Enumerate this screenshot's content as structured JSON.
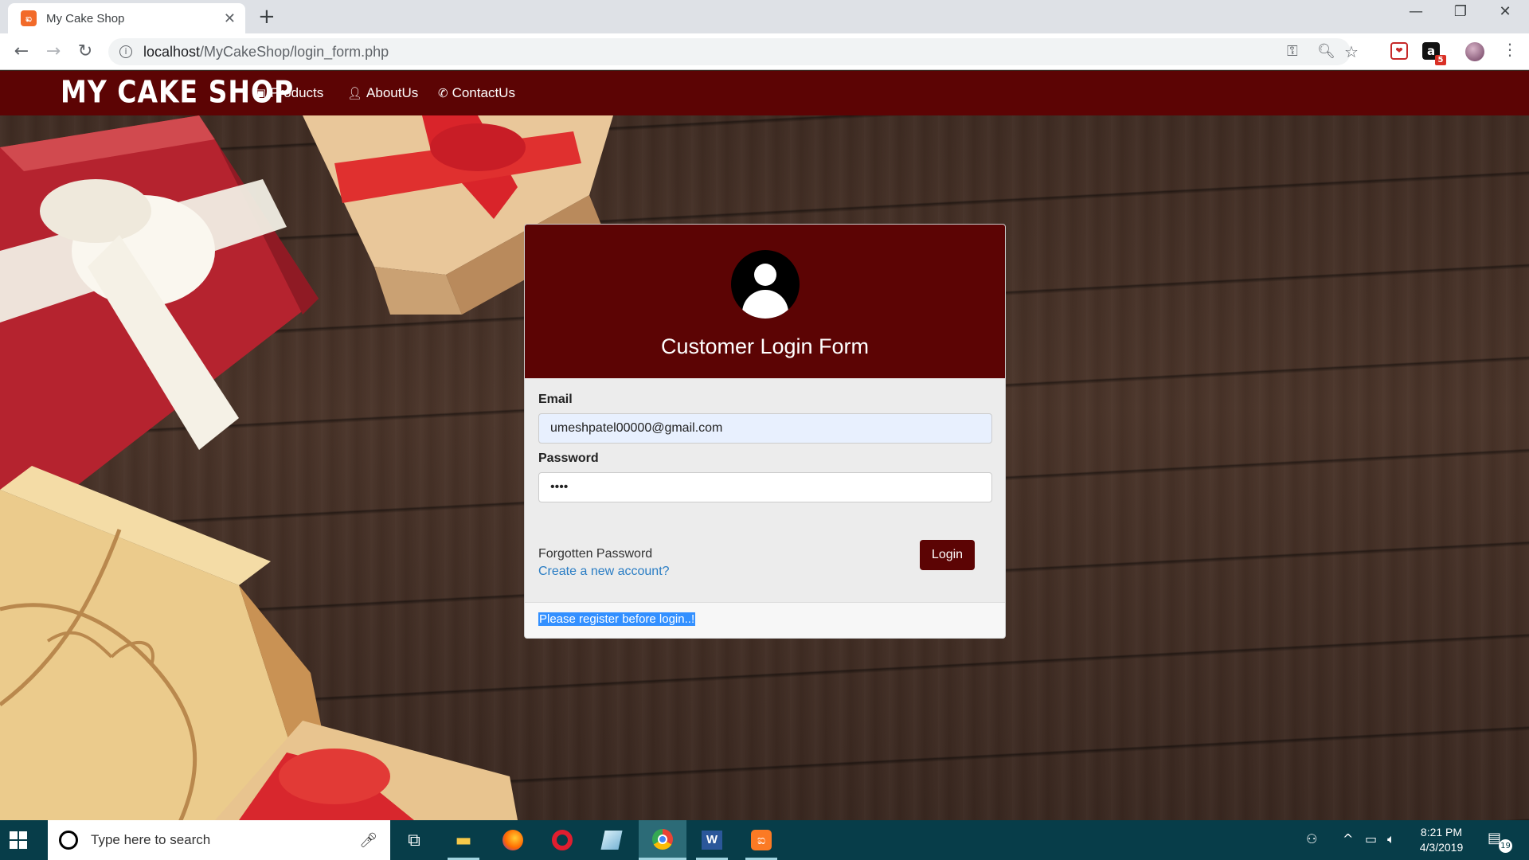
{
  "browser": {
    "tab_title": "My Cake Shop",
    "tab_favicon": "xampp-icon",
    "tab_close": "✕",
    "new_tab": "+",
    "url_host": "localhost",
    "url_path": "/MyCakeShop/login_form.php",
    "window": {
      "minimize": "—",
      "restore": "❐",
      "close": "✕"
    },
    "extension_badge": "5"
  },
  "site": {
    "brand": "MY CAKE SHOP",
    "nav": [
      {
        "label": "Products",
        "icon": "products-icon"
      },
      {
        "label": "AboutUs",
        "icon": "user-icon"
      },
      {
        "label": "ContactUs",
        "icon": "phone-icon"
      }
    ],
    "theme_color": "#5c0404"
  },
  "login": {
    "title": "Customer Login Form",
    "email_label": "Email",
    "email_value": "umeshpatel00000@gmail.com",
    "password_label": "Password",
    "password_value": "••••",
    "forgot": "Forgotten Password",
    "create": "Create a new account?",
    "button": "Login",
    "message": "Please register before login..!"
  },
  "taskbar": {
    "search_placeholder": "Type here to search",
    "time": "8:21 PM",
    "date": "4/3/2019",
    "notifications": "19",
    "apps": [
      "task-view",
      "file-explorer",
      "firefox",
      "opera",
      "notepad",
      "chrome",
      "word",
      "xampp"
    ]
  }
}
